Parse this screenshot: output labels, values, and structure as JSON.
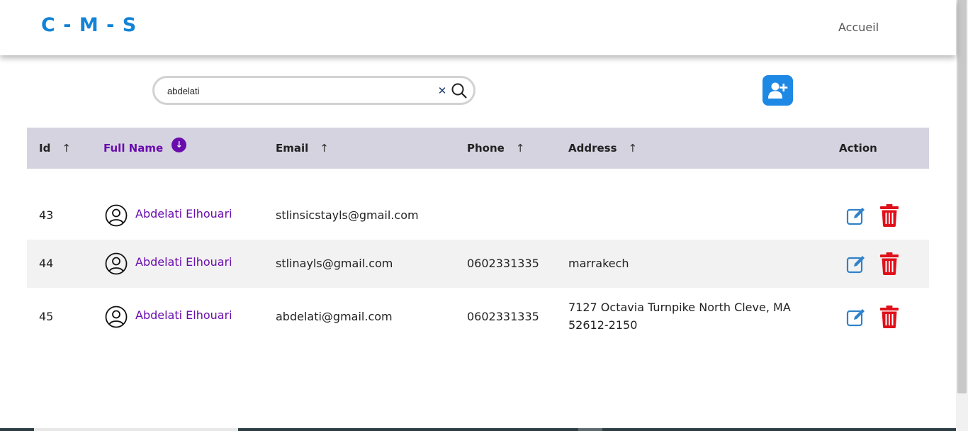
{
  "navbar": {
    "brand": "C - M - S",
    "links": [
      {
        "label": "Accueil"
      }
    ]
  },
  "search": {
    "value": "abdelati",
    "placeholder": ""
  },
  "toolbar": {
    "add_user_icon": "user-plus-icon"
  },
  "table": {
    "columns": [
      {
        "label": "Id",
        "sort": "asc"
      },
      {
        "label": "Full Name",
        "sort": "active-desc"
      },
      {
        "label": "Email",
        "sort": "asc"
      },
      {
        "label": "Phone",
        "sort": "asc"
      },
      {
        "label": "Address",
        "sort": "asc"
      },
      {
        "label": "Action",
        "sort": "none"
      }
    ],
    "rows": [
      {
        "id": "43",
        "name": "Abdelati Elhouari",
        "email": "stlinsicstayls@gmail.com",
        "phone": "",
        "address_line1": "",
        "address_line2": ""
      },
      {
        "id": "44",
        "name": "Abdelati Elhouari",
        "email": "stlinayls@gmail.com",
        "phone": "0602331335",
        "address_line1": "marrakech",
        "address_line2": ""
      },
      {
        "id": "45",
        "name": "Abdelati Elhouari",
        "email": "abdelati@gmail.com",
        "phone": "0602331335",
        "address_line1": "7127 Octavia Turnpike North Cleve, MA",
        "address_line2": "52612-2150"
      }
    ],
    "sort_arrow": "↑",
    "active_sort_arrow": "↓"
  },
  "colors": {
    "brand": "#1283d6",
    "accent": "#6a0dad",
    "header_bg": "#d6d3e0",
    "add_button": "#1e88e5",
    "delete": "#e0101a",
    "edit": "#2f82c9"
  }
}
